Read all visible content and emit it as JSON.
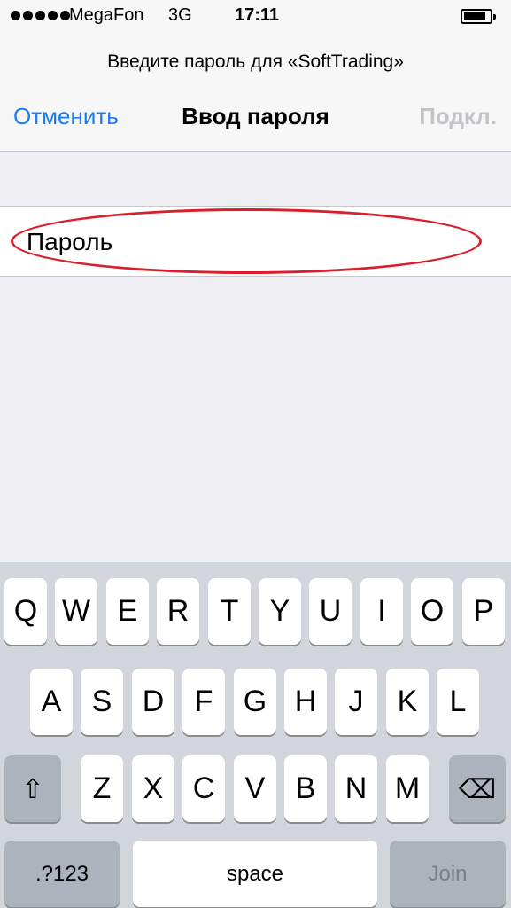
{
  "status_bar": {
    "carrier": "MegaFon",
    "network": "3G",
    "time": "17:11",
    "signal_icon": "signal-dots-icon",
    "battery_icon": "battery-icon"
  },
  "nav": {
    "prompt": "Введите пароль для «SoftTrading»",
    "cancel_label": "Отменить",
    "title": "Ввод пароля",
    "connect_label": "Подкл."
  },
  "password_field": {
    "placeholder": "Пароль",
    "annotation_color": "#d81f2a"
  },
  "keyboard": {
    "row1": [
      "Q",
      "W",
      "E",
      "R",
      "T",
      "Y",
      "U",
      "I",
      "O",
      "P"
    ],
    "row2": [
      "A",
      "S",
      "D",
      "F",
      "G",
      "H",
      "J",
      "K",
      "L"
    ],
    "row3": [
      "Z",
      "X",
      "C",
      "V",
      "B",
      "N",
      "M"
    ],
    "shift_glyph": "⇧",
    "delete_glyph": "⌫",
    "numbers_label": ".?123",
    "space_label": "space",
    "join_label": "Join"
  },
  "colors": {
    "accent": "#1b7cf4",
    "disabled": "#c4c4c8",
    "keyboard_bg": "#d2d5db"
  }
}
